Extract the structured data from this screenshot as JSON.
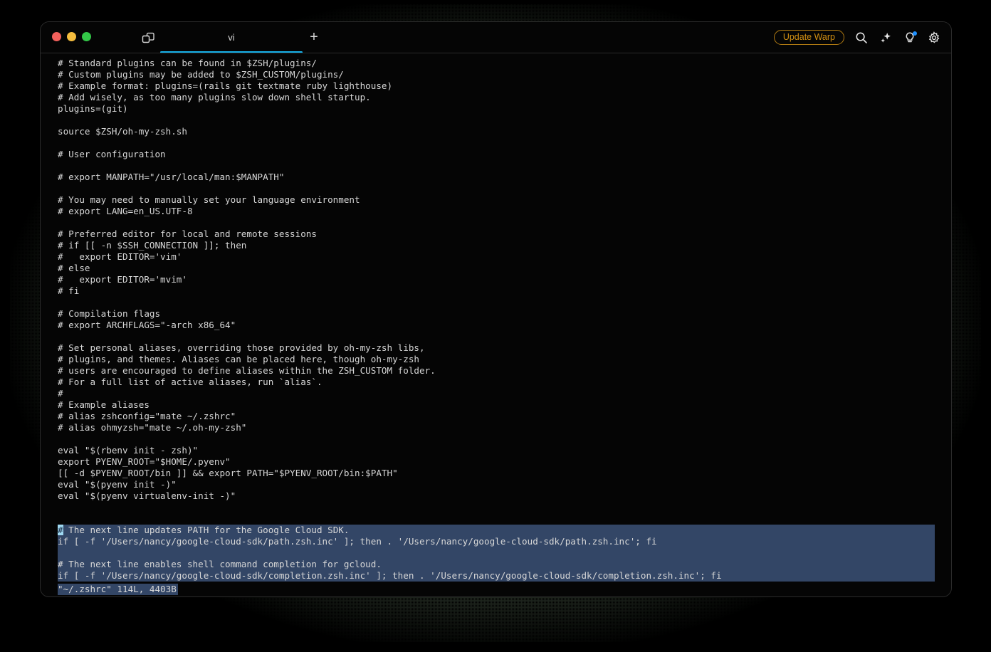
{
  "window": {
    "traffic_lights": [
      "close",
      "minimize",
      "maximize"
    ],
    "split_pane_icon": "split-pane-icon"
  },
  "tabbar": {
    "tab_label": "vi",
    "new_tab_label": "+",
    "accent_color": "#16b0e8"
  },
  "toolbar": {
    "update_label": "Update Warp",
    "update_color": "#d08e12",
    "icons": [
      "search-icon",
      "ai-sparkle-icon",
      "lightbulb-icon",
      "gear-icon"
    ],
    "notification_dot_color": "#1e90ff"
  },
  "terminal": {
    "foreground": "#d7d7d7",
    "background": "#050505",
    "selection_background": "#334666",
    "cursor_background": "#9fd9f2",
    "lines": [
      "# Standard plugins can be found in $ZSH/plugins/",
      "# Custom plugins may be added to $ZSH_CUSTOM/plugins/",
      "# Example format: plugins=(rails git textmate ruby lighthouse)",
      "# Add wisely, as too many plugins slow down shell startup.",
      "plugins=(git)",
      "",
      "source $ZSH/oh-my-zsh.sh",
      "",
      "# User configuration",
      "",
      "# export MANPATH=\"/usr/local/man:$MANPATH\"",
      "",
      "# You may need to manually set your language environment",
      "# export LANG=en_US.UTF-8",
      "",
      "# Preferred editor for local and remote sessions",
      "# if [[ -n $SSH_CONNECTION ]]; then",
      "#   export EDITOR='vim'",
      "# else",
      "#   export EDITOR='mvim'",
      "# fi",
      "",
      "# Compilation flags",
      "# export ARCHFLAGS=\"-arch x86_64\"",
      "",
      "# Set personal aliases, overriding those provided by oh-my-zsh libs,",
      "# plugins, and themes. Aliases can be placed here, though oh-my-zsh",
      "# users are encouraged to define aliases within the ZSH_CUSTOM folder.",
      "# For a full list of active aliases, run `alias`.",
      "#",
      "# Example aliases",
      "# alias zshconfig=\"mate ~/.zshrc\"",
      "# alias ohmyzsh=\"mate ~/.oh-my-zsh\"",
      "",
      "eval \"$(rbenv init - zsh)\"",
      "export PYENV_ROOT=\"$HOME/.pyenv\"",
      "[[ -d $PYENV_ROOT/bin ]] && export PATH=\"$PYENV_ROOT/bin:$PATH\"",
      "eval \"$(pyenv init -)\"",
      "eval \"$(pyenv virtualenv-init -)\"",
      "",
      ""
    ],
    "selected_lines": {
      "cursor_char": "#",
      "line1_rest": " The next line updates PATH for the Google Cloud SDK.",
      "line2": "if [ -f '/Users/nancy/google-cloud-sdk/path.zsh.inc' ]; then . '/Users/nancy/google-cloud-sdk/path.zsh.inc'; fi",
      "line3": "",
      "line4": "# The next line enables shell command completion for gcloud.",
      "line5": "if [ -f '/Users/nancy/google-cloud-sdk/completion.zsh.inc' ]; then . '/Users/nancy/google-cloud-sdk/completion.zsh.inc'; fi"
    },
    "status_line": "\"~/.zshrc\" 114L, 4403B"
  }
}
